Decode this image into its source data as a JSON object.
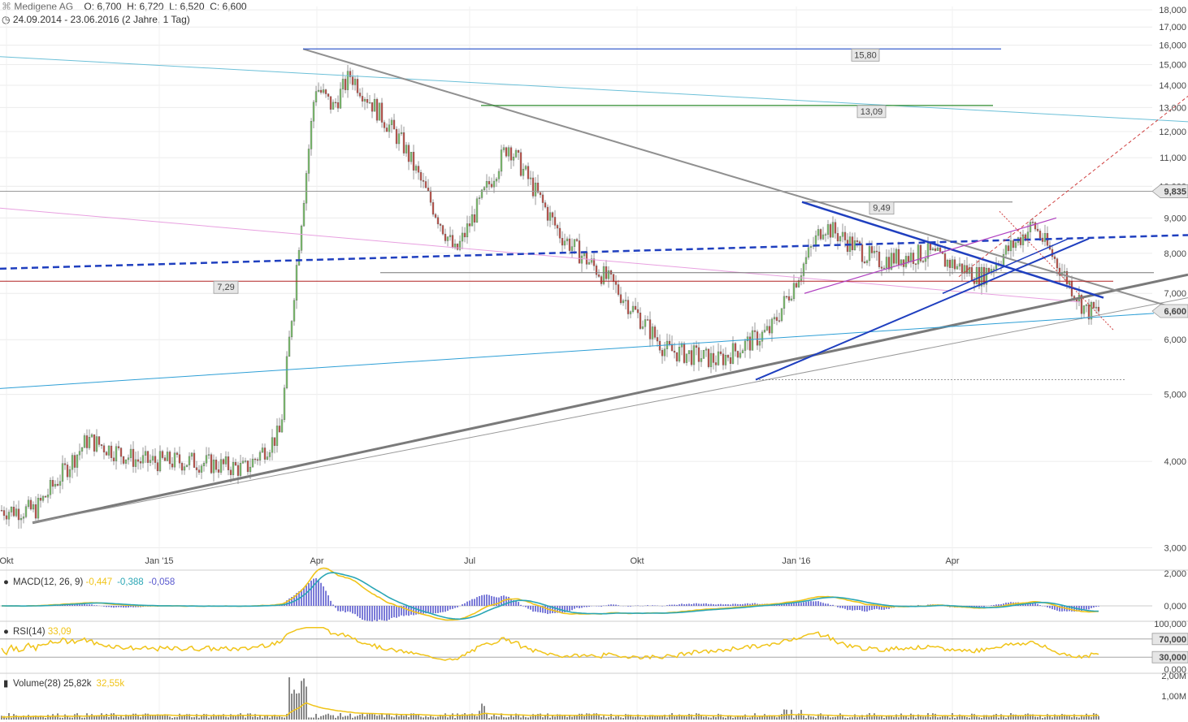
{
  "header": {
    "instrument": "Medigene AG",
    "ohlc": {
      "open": "O: 6,700",
      "high": "H: 6,720",
      "low": "L: 6,520",
      "close": "C: 6,600"
    },
    "range": "24.09.2014 - 23.06.2016 (2 Jahre, 1 Tag)"
  },
  "chart_data": [
    {
      "type": "line",
      "name": "price",
      "title": "",
      "x_ticks": [
        "Okt",
        "Jan '15",
        "Apr",
        "Jul",
        "Okt",
        "Jan '16",
        "Apr"
      ],
      "y_ticks": [
        "3,000",
        "4,000",
        "5,000",
        "6,000",
        "7,000",
        "8,000",
        "9,000",
        "10,000",
        "11,000",
        "12,000",
        "13,000",
        "14,000",
        "15,000",
        "16,000",
        "17,000",
        "18,000"
      ],
      "y_scale": "log",
      "ylim": [
        2.8,
        18.2
      ],
      "x": [
        "2014-10",
        "2014-11",
        "2014-12",
        "2015-01",
        "2015-02",
        "2015-03-05",
        "2015-03-15",
        "2015-03-25",
        "2015-04-05",
        "2015-04-15",
        "2015-05",
        "2015-06",
        "2015-07",
        "2015-08",
        "2015-09",
        "2015-10",
        "2015-11",
        "2015-12",
        "2016-01",
        "2016-02",
        "2016-03",
        "2016-04",
        "2016-05",
        "2016-06"
      ],
      "close": [
        3.4,
        4.3,
        4.0,
        4.0,
        3.9,
        4.4,
        8.0,
        14.0,
        13.0,
        14.5,
        11.5,
        8.0,
        11.5,
        8.5,
        7.2,
        5.8,
        5.6,
        6.2,
        8.8,
        7.8,
        8.0,
        7.4,
        8.8,
        6.6
      ],
      "levels": [
        {
          "label": "15,80",
          "value": 15.8
        },
        {
          "label": "13,09",
          "value": 13.09
        },
        {
          "label": "9,49",
          "value": 9.49
        },
        {
          "label": "7,29",
          "value": 7.29
        }
      ],
      "price_badges": [
        {
          "label": "9,835",
          "value": 9.835
        },
        {
          "label": "6,600",
          "value": 6.6
        }
      ]
    },
    {
      "type": "line",
      "name": "macd",
      "title": "MACD(12, 26, 9)",
      "values": [
        "-0,447",
        "-0,388",
        "-0,058"
      ],
      "y_ticks": [
        "2,000",
        "0,000"
      ],
      "colors": {
        "macd": "#f0c419",
        "signal": "#2aa6b5",
        "histogram": "#5a5acf"
      }
    },
    {
      "type": "line",
      "name": "rsi",
      "title": "RSI(14)",
      "value": "33,09",
      "y_ticks": [
        "100,000",
        "0,000"
      ],
      "badges": [
        "70,000",
        "30,000"
      ],
      "color": "#f0c419"
    },
    {
      "type": "bar",
      "name": "volume",
      "title": "Volume(28)",
      "values": [
        "25,82k",
        "32,55k"
      ],
      "y_ticks": [
        "2,00M",
        "1,00M"
      ],
      "color": "#f0c419"
    }
  ],
  "colors": {
    "up": "#7cbf6e",
    "down": "#c0554c",
    "trend_blue": "#1f3fbf",
    "trend_gray": "#808080",
    "red_line": "#b22222"
  }
}
